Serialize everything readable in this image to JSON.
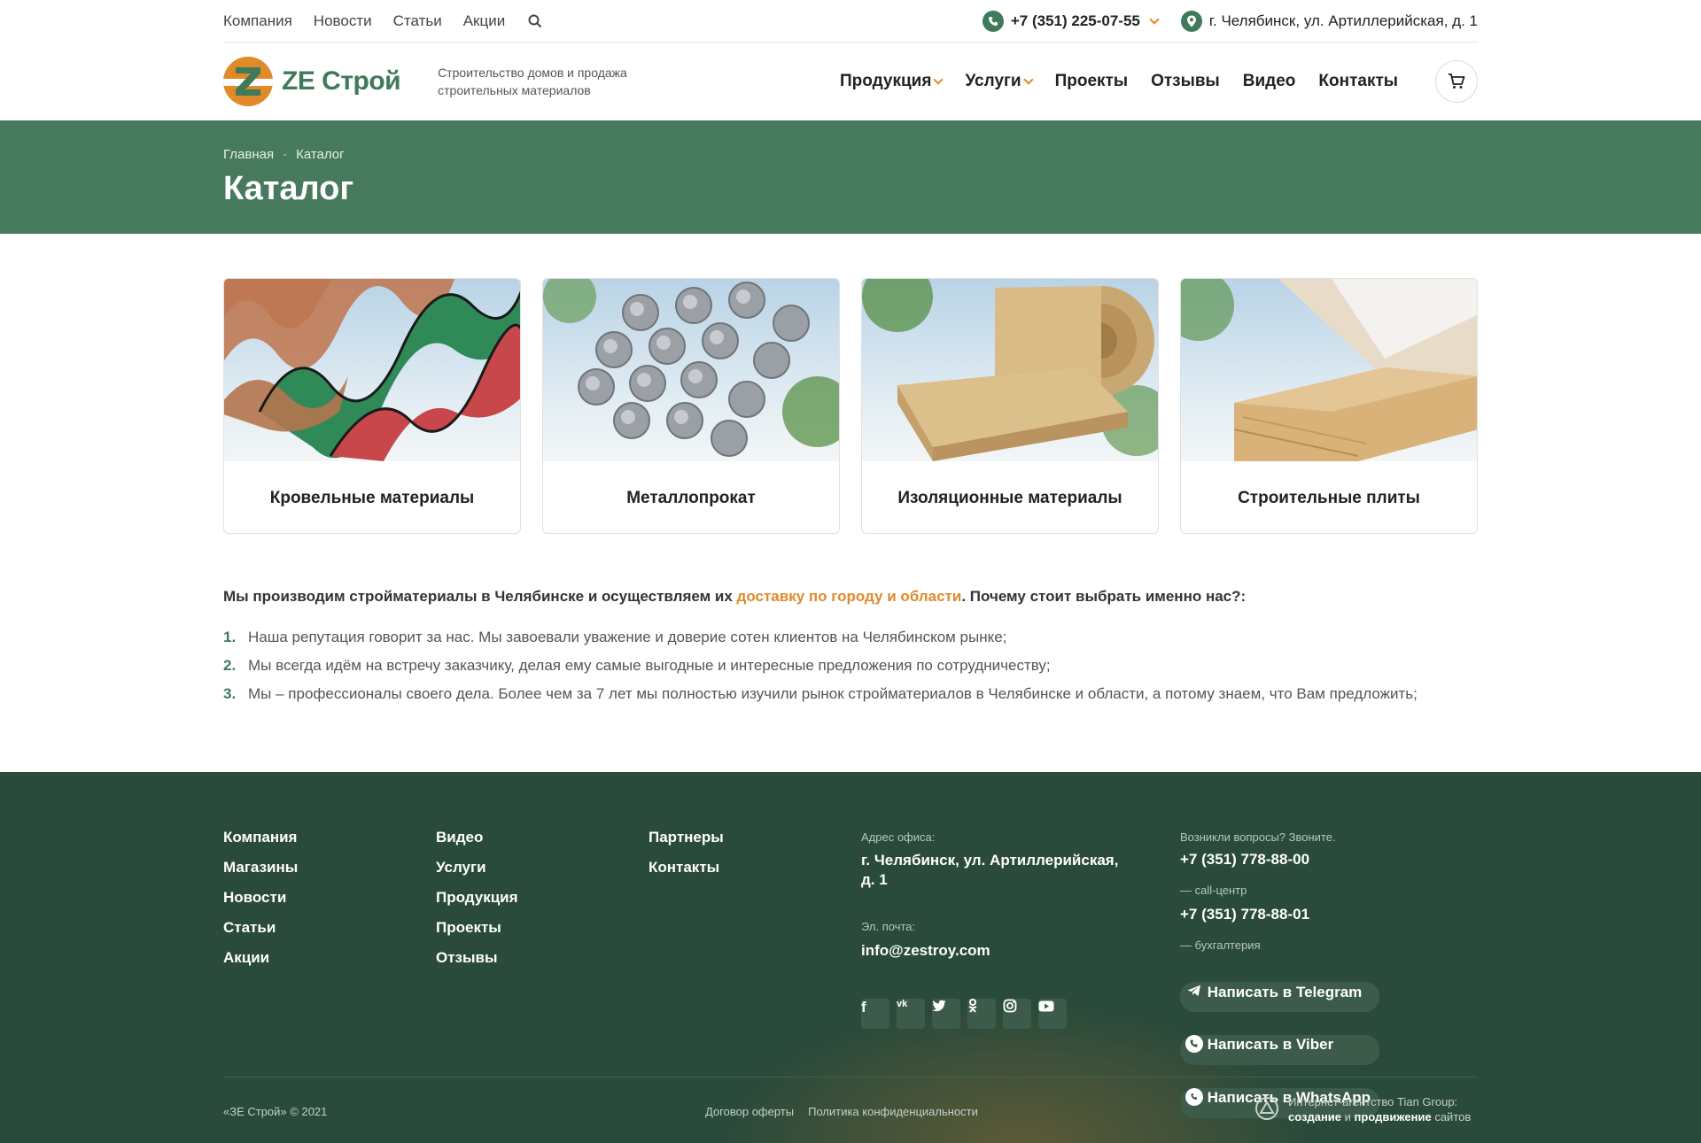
{
  "topbar": {
    "nav": [
      "Компания",
      "Новости",
      "Статьи",
      "Акции"
    ],
    "phone": "+7 (351) 225-07-55",
    "address": "г. Челябинск, ул. Артиллерийская, д. 1"
  },
  "header": {
    "logo_text": "ZE Строй",
    "tagline": "Строительство домов и продажа строительных материалов",
    "nav": [
      {
        "label": "Продукция",
        "has_dropdown": true
      },
      {
        "label": "Услуги",
        "has_dropdown": true
      },
      {
        "label": "Проекты",
        "has_dropdown": false
      },
      {
        "label": "Отзывы",
        "has_dropdown": false
      },
      {
        "label": "Видео",
        "has_dropdown": false
      },
      {
        "label": "Контакты",
        "has_dropdown": false
      }
    ]
  },
  "hero": {
    "breadcrumb": [
      "Главная",
      "Каталог"
    ],
    "title": "Каталог"
  },
  "catalog": {
    "cards": [
      {
        "title": "Кровельные материалы",
        "image": "roofing-image"
      },
      {
        "title": "Металлопрокат",
        "image": "rebar-image"
      },
      {
        "title": "Изоляционные материалы",
        "image": "insulation-image"
      },
      {
        "title": "Строительные плиты",
        "image": "boards-image"
      }
    ]
  },
  "intro": {
    "before": "Мы производим стройматериалы в Челябинске и осуществляем их ",
    "link": "доставку по городу и области",
    "after": ". Почему стоит выбрать именно нас?:"
  },
  "reasons": [
    {
      "num": "1.",
      "text": "Наша репутация говорит за нас. Мы завоевали уважение и доверие сотен клиентов на Челябинском рынке;"
    },
    {
      "num": "2.",
      "text": "Мы всегда идём на встречу заказчику, делая ему самые выгодные и интересные предложения по сотрудничеству;"
    },
    {
      "num": "3.",
      "text": "Мы – профессионалы своего дела. Более чем за 7 лет мы полностью изучили рынок стройматериалов в Челябинске и области, а потому знаем, что Вам предложить;"
    }
  ],
  "footer": {
    "col1": [
      "Компания",
      "Магазины",
      "Новости",
      "Статьи",
      "Акции"
    ],
    "col2": [
      "Видео",
      "Услуги",
      "Продукция",
      "Проекты",
      "Отзывы"
    ],
    "col3": [
      "Партнеры",
      "Контакты"
    ],
    "office_label": "Адрес офиса:",
    "office_address": "г. Челябинск, ул. Артиллерийская, д. 1",
    "email_label": "Эл. почта:",
    "email": "info@zestroy.com",
    "socials": [
      "f",
      "vk",
      "tw",
      "ok",
      "ig",
      "yt"
    ],
    "questions_label": "Возникли вопросы? Звоните.",
    "phones": [
      {
        "number": "+7 (351) 778-88-00",
        "note": "— call-центр"
      },
      {
        "number": "+7 (351) 778-88-01",
        "note": "— бухгалтерия"
      }
    ],
    "messengers": [
      "Написать в Telegram",
      "Написать в Viber",
      "Написать в WhatsApp"
    ],
    "copyright": "«ЗЕ Строй» © 2021",
    "legal": [
      "Договор оферты",
      "Политика конфиденциальности"
    ],
    "agency_line1": "Интернет-агентство Tian Group:",
    "agency_word1": "создание",
    "agency_and": "и",
    "agency_word2": "продвижение",
    "agency_tail": "сайтов"
  },
  "colors": {
    "accent": "#e08a2a",
    "brand_green": "#3f7a5b",
    "hero_bg": "#477a5d",
    "footer_bg": "#2a4a3b"
  }
}
